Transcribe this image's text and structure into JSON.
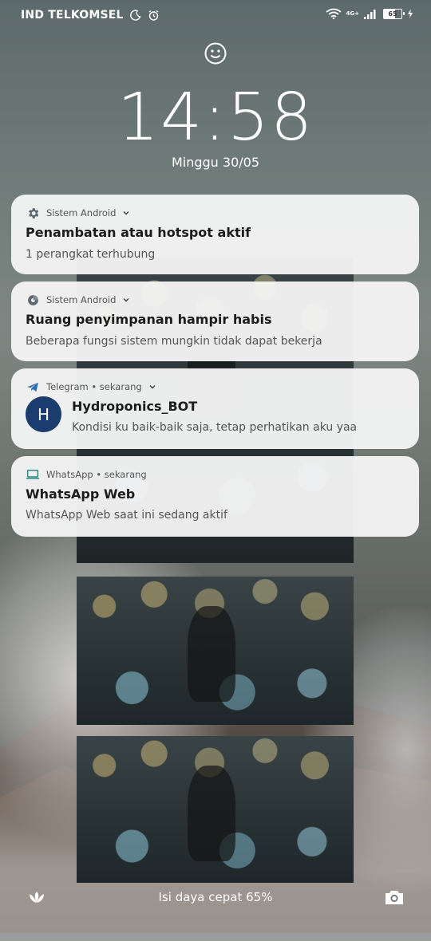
{
  "status_bar": {
    "carrier": "IND TELKOMSEL",
    "network": "4G+",
    "battery": "65"
  },
  "lockscreen": {
    "time": "14:58",
    "date": "Minggu 30/05"
  },
  "notifications": [
    {
      "app": "Sistem Android",
      "app_icon": "gear-icon",
      "title": "Penambatan atau hotspot aktif",
      "body": "1 perangkat terhubung"
    },
    {
      "app": "Sistem Android",
      "app_icon": "storage-icon",
      "title": "Ruang penyimpanan hampir habis",
      "body": "Beberapa fungsi sistem mungkin tidak dapat bekerja"
    },
    {
      "app": "Telegram • sekarang",
      "app_icon": "telegram-icon",
      "avatar_letter": "H",
      "title": "Hydroponics_BOT",
      "body": "Kondisi ku baik-baik saja, tetap perhatikan aku yaa"
    },
    {
      "app": "WhatsApp • sekarang",
      "app_icon": "laptop-icon",
      "title": "WhatsApp Web",
      "body": "WhatsApp Web saat ini sedang aktif"
    }
  ],
  "bottom": {
    "charging_text": "Isi daya cepat 65%"
  },
  "colors": {
    "card_bg": "#f4f4f4",
    "avatar_bg": "#1b3c6e",
    "title_text": "#1c1c1c"
  }
}
